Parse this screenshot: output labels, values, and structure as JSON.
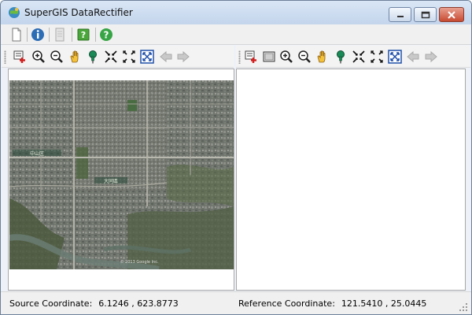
{
  "window": {
    "title": "SuperGIS DataRectifier"
  },
  "main_toolbar": {
    "items": [
      {
        "name": "new-document-icon"
      },
      {
        "name": "info-icon"
      },
      {
        "name": "document-disabled-icon"
      },
      {
        "name": "help-book-icon"
      },
      {
        "name": "help-question-icon"
      }
    ]
  },
  "source_toolbar": {
    "tools": [
      "add-data-icon",
      "zoom-in-icon",
      "zoom-out-icon",
      "pan-icon",
      "pin-icon",
      "zoom-fixed-in-icon",
      "zoom-fixed-out-icon",
      "full-extent-icon",
      "back-arrow-icon",
      "forward-arrow-icon"
    ]
  },
  "reference_toolbar": {
    "tools": [
      "add-data-icon",
      "layer-icon",
      "zoom-in-icon",
      "zoom-out-icon",
      "pan-icon",
      "pin-icon",
      "zoom-fixed-in-icon",
      "zoom-fixed-out-icon",
      "full-extent-icon",
      "back-arrow-icon",
      "forward-arrow-icon"
    ]
  },
  "status": {
    "source_label": "Source Coordinate:",
    "source_value": "6.1246 , 623.8773",
    "reference_label": "Reference Coordinate:",
    "reference_value": "121.5410 , 25.0445"
  },
  "map": {
    "watermark": "© 2013 Google Inc.",
    "label_1": "中山区",
    "label_2": "大同區"
  },
  "colors": {
    "titlebar": "#c9d9ee",
    "close_button": "#c84b32",
    "pin_green": "#1a8a57"
  }
}
